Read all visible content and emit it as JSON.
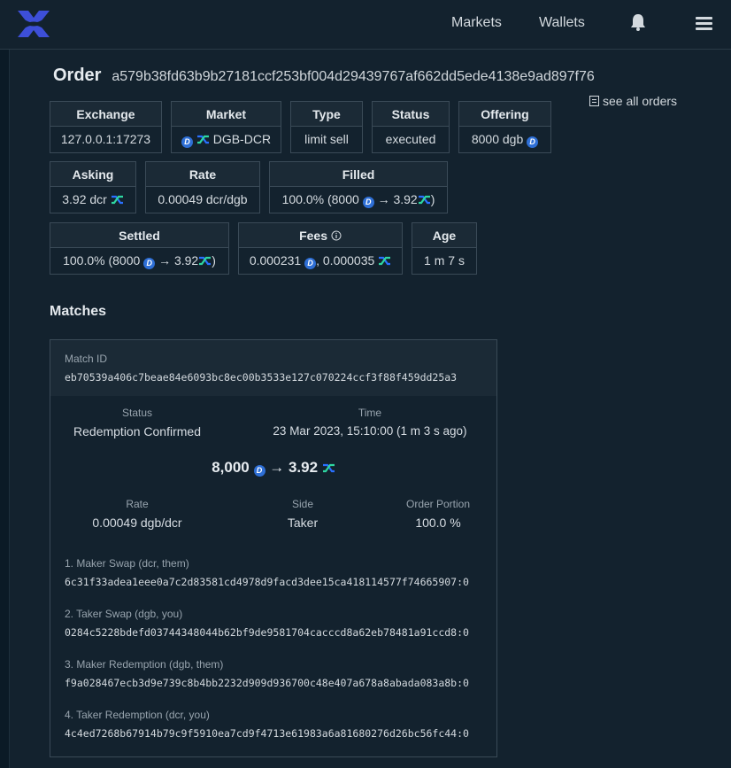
{
  "nav": {
    "markets": "Markets",
    "wallets": "Wallets"
  },
  "order": {
    "label": "Order",
    "id": "a579b38fd63b9b27181ccf253bf004d29439767af662dd5ede4138e9ad897f76",
    "see_all": "see all orders"
  },
  "boxes": {
    "exchange": {
      "label": "Exchange",
      "value": "127.0.0.1:17273"
    },
    "market": {
      "label": "Market",
      "value": "DGB-DCR"
    },
    "type": {
      "label": "Type",
      "value": "limit sell"
    },
    "status": {
      "label": "Status",
      "value": "executed"
    },
    "offering": {
      "label": "Offering",
      "value": "8000 dgb"
    },
    "asking": {
      "label": "Asking",
      "value": "3.92 dcr"
    },
    "rate": {
      "label": "Rate",
      "value": "0.00049 dcr/dgb"
    },
    "filled": {
      "label": "Filled",
      "pct": "100.0% (8000",
      "arrow": "→ 3.92",
      "close": ")"
    },
    "settled": {
      "label": "Settled",
      "pct": "100.0% (8000",
      "arrow": "→ 3.92",
      "close": ")"
    },
    "fees": {
      "label": "Fees",
      "dgb": "0.000231",
      "sep": ", 0.000035"
    },
    "age": {
      "label": "Age",
      "value": "1 m 7 s"
    }
  },
  "matches": {
    "heading": "Matches",
    "match_id_label": "Match ID",
    "match_id": "eb70539a406c7beae84e6093bc8ec00b3533e127c070224ccf3f88f459dd25a3",
    "status_label": "Status",
    "status": "Redemption Confirmed",
    "time_label": "Time",
    "time": "23 Mar 2023, 15:10:00 (1 m 3 s ago)",
    "amount_from": "8,000",
    "amount_to": "→ 3.92",
    "rate_label": "Rate",
    "rate": "0.00049 dgb/dcr",
    "side_label": "Side",
    "side": "Taker",
    "portion_label": "Order Portion",
    "portion": "100.0 %",
    "swaps": [
      {
        "label": "1. Maker Swap (dcr, them)",
        "tx": "6c31f33adea1eee0a7c2d83581cd4978d9facd3dee15ca418114577f74665907:0"
      },
      {
        "label": "2. Taker Swap (dgb, you)",
        "tx": "0284c5228bdefd03744348044b62bf9de9581704cacccd8a62eb78481a91ccd8:0"
      },
      {
        "label": "3. Maker Redemption (dgb, them)",
        "tx": "f9a028467ecb3d9e739c8b4bb2232d909d936700c48e407a678a8abada083a8b:0"
      },
      {
        "label": "4. Taker Redemption (dcr, you)",
        "tx": "4c4ed7268b67914b79c9f5910ea7cd9f4713e61983a6a81680276d26bc56fc44:0"
      }
    ]
  },
  "colors": {
    "background": "#13222e",
    "accent_dgb": "#2e6fd6",
    "accent_dcr_blue": "#2970ff",
    "accent_dcr_teal": "#2ed6a1"
  },
  "icons": [
    "dex-logo-icon",
    "bell-icon",
    "hamburger-menu-icon",
    "document-icon",
    "dgb-coin-icon",
    "dcr-coin-icon",
    "info-icon"
  ]
}
